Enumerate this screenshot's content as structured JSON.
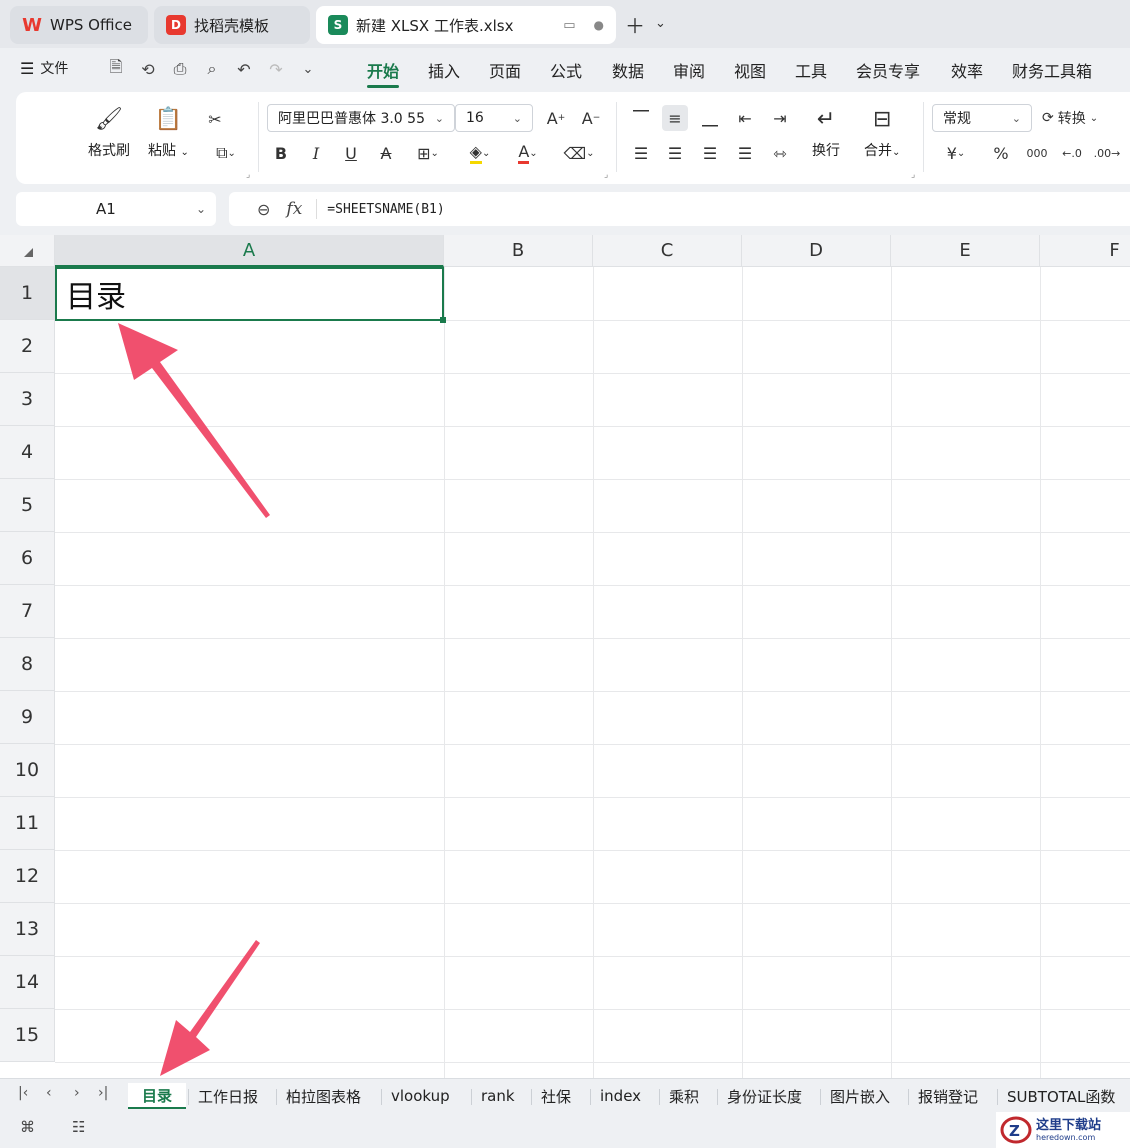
{
  "window_tabs": [
    {
      "label": "WPS Office",
      "icon": "wps-logo-icon",
      "color": "#e8392f"
    },
    {
      "label": "找稻壳模板",
      "icon": "docer-icon",
      "color": "#e8392f"
    },
    {
      "label": "新建 XLSX 工作表.xlsx",
      "icon": "spreadsheet-icon",
      "color": "#1a8a5a",
      "active": true
    }
  ],
  "menu": {
    "file_label": "文件",
    "tabs": [
      "开始",
      "插入",
      "页面",
      "公式",
      "数据",
      "审阅",
      "视图",
      "工具",
      "会员专享",
      "效率",
      "财务工具箱"
    ],
    "active_tab": "开始"
  },
  "ribbon": {
    "format_painter": "格式刷",
    "paste": "粘贴",
    "font_name": "阿里巴巴普惠体 3.0 55",
    "font_size": "16",
    "wrap": "换行",
    "merge": "合并",
    "number_format": "常规",
    "convert": "转换",
    "currency_symbol": "¥",
    "percent_symbol": "%",
    "thousands_symbol": "000"
  },
  "formula_bar": {
    "cell_ref": "A1",
    "fx_label": "fx",
    "formula": "=SHEETSNAME(B1)"
  },
  "grid": {
    "columns": [
      "A",
      "B",
      "C",
      "D",
      "E",
      "F"
    ],
    "rows": [
      "1",
      "2",
      "3",
      "4",
      "5",
      "6",
      "7",
      "8",
      "9",
      "10",
      "11",
      "12",
      "13",
      "14",
      "15"
    ],
    "active_cell_value": "目录"
  },
  "sheets": [
    "目录",
    "工作日报",
    "柏拉图表格",
    "vlookup",
    "rank",
    "社保",
    "index",
    "乘积",
    "身份证长度",
    "图片嵌入",
    "报销登记",
    "SUBTOTAL函数"
  ],
  "active_sheet": "目录",
  "watermark": {
    "title": "这里下载站",
    "url": "heredown.com"
  },
  "accent_color": "#1a7a4c",
  "arrow_color": "#f0506e"
}
